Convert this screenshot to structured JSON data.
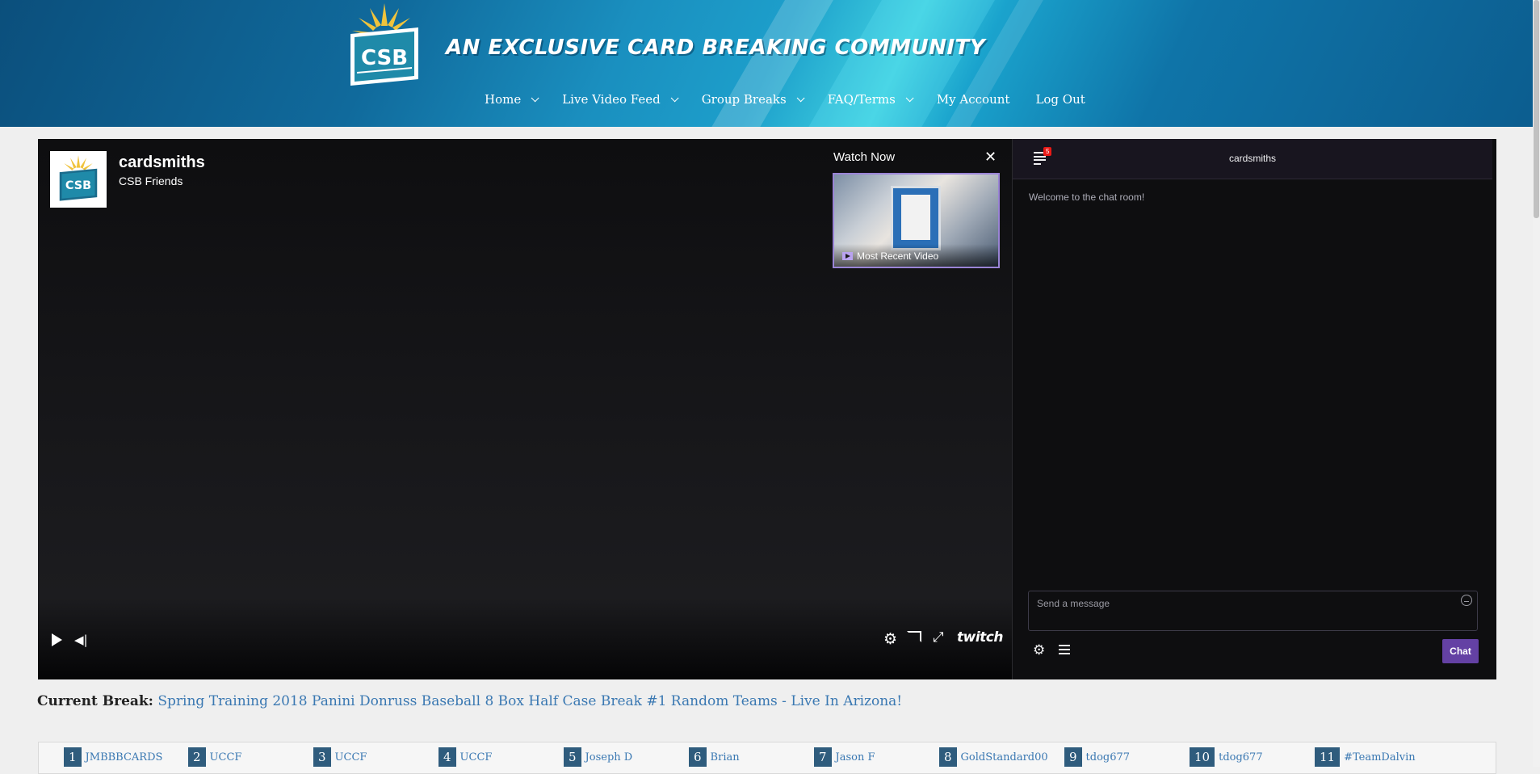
{
  "header": {
    "tagline": "AN EXCLUSIVE CARD BREAKING COMMUNITY",
    "logo_text": "CSB",
    "nav": [
      {
        "label": "Home",
        "has_dropdown": true
      },
      {
        "label": "Live Video Feed",
        "has_dropdown": true
      },
      {
        "label": "Group Breaks",
        "has_dropdown": true
      },
      {
        "label": "FAQ/Terms",
        "has_dropdown": true
      },
      {
        "label": "My Account",
        "has_dropdown": false
      },
      {
        "label": "Log Out",
        "has_dropdown": false
      }
    ]
  },
  "player": {
    "channel_name": "cardsmiths",
    "channel_subtitle": "CSB Friends",
    "watch_now_label": "Watch Now",
    "recent_video_label": "Most Recent Video",
    "twitch_label": "twitch",
    "icons": [
      "play-icon",
      "volume-icon",
      "settings-icon",
      "cast-icon",
      "fullscreen-icon",
      "twitch-logo"
    ]
  },
  "chat": {
    "title": "cardsmiths",
    "badge_count": "5",
    "welcome": "Welcome to the chat room!",
    "input_placeholder": "Send a message",
    "send_label": "Chat",
    "accent_color": "#6441a4"
  },
  "current_break": {
    "label": "Current Break:",
    "title": "Spring Training 2018 Panini Donruss Baseball 8 Box Half Case Break #1 Random Teams - Live In Arizona!"
  },
  "teams": [
    {
      "num": "1",
      "name": "JMBBBCARDS"
    },
    {
      "num": "2",
      "name": "UCCF"
    },
    {
      "num": "3",
      "name": "UCCF"
    },
    {
      "num": "4",
      "name": "UCCF"
    },
    {
      "num": "5",
      "name": "Joseph D"
    },
    {
      "num": "6",
      "name": "Brian"
    },
    {
      "num": "7",
      "name": "Jason F"
    },
    {
      "num": "8",
      "name": "GoldStandard00"
    },
    {
      "num": "9",
      "name": "tdog677"
    },
    {
      "num": "10",
      "name": "tdog677"
    },
    {
      "num": "11",
      "name": "#TeamDalvin"
    }
  ],
  "colors": {
    "link": "#3a78b2",
    "team_number_bg": "#2f5c7d",
    "header_blue": "#106a9c"
  }
}
